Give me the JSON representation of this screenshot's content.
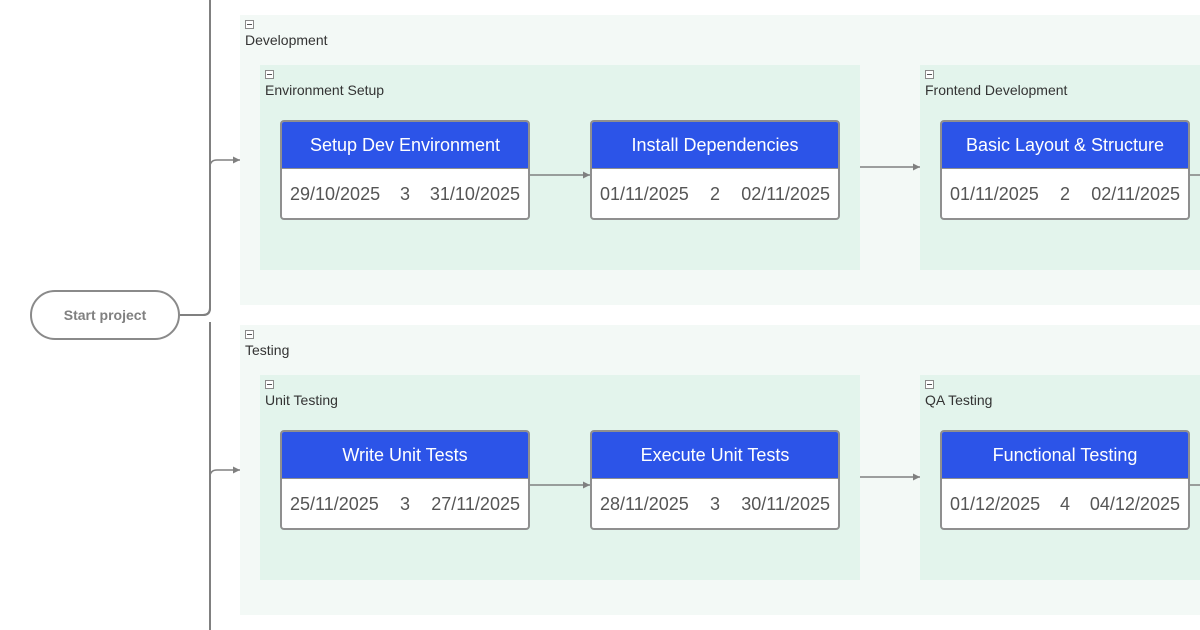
{
  "start_node": {
    "label": "Start project"
  },
  "groups": {
    "development": {
      "label": "Development",
      "subgroups": {
        "environment_setup": {
          "label": "Environment Setup",
          "tasks": [
            {
              "title": "Setup Dev Environment",
              "start": "29/10/2025",
              "duration": "3",
              "end": "31/10/2025"
            },
            {
              "title": "Install Dependencies",
              "start": "01/11/2025",
              "duration": "2",
              "end": "02/11/2025"
            }
          ]
        },
        "frontend_development": {
          "label": "Frontend Development",
          "tasks": [
            {
              "title": "Basic Layout & Structure",
              "start": "01/11/2025",
              "duration": "2",
              "end": "02/11/2025"
            }
          ]
        }
      }
    },
    "testing": {
      "label": "Testing",
      "subgroups": {
        "unit_testing": {
          "label": "Unit Testing",
          "tasks": [
            {
              "title": "Write Unit Tests",
              "start": "25/11/2025",
              "duration": "3",
              "end": "27/11/2025"
            },
            {
              "title": "Execute Unit Tests",
              "start": "28/11/2025",
              "duration": "3",
              "end": "30/11/2025"
            }
          ]
        },
        "qa_testing": {
          "label": "QA Testing",
          "tasks": [
            {
              "title": "Functional Testing",
              "start": "01/12/2025",
              "duration": "4",
              "end": "04/12/2025"
            }
          ]
        }
      }
    }
  },
  "colors": {
    "task_header": "#2c54e8",
    "outer_group_bg": "#f3f9f6",
    "inner_group_bg": "#e3f4ec",
    "connector": "#808080"
  }
}
